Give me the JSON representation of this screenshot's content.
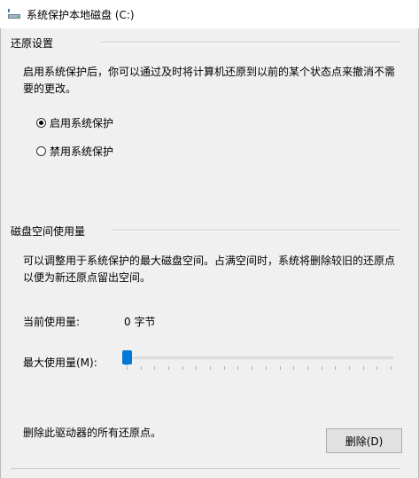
{
  "window": {
    "title": "系统保护本地磁盘 (C:)",
    "icon": "drive-icon"
  },
  "restore": {
    "group_title": "还原设置",
    "description": "启用系统保护后，你可以通过及时将计算机还原到以前的某个状态点来撤消不需要的更改。",
    "options": [
      {
        "label": "启用系统保护",
        "checked": true
      },
      {
        "label": "禁用系统保护",
        "checked": false
      }
    ]
  },
  "disk_space": {
    "group_title": "磁盘空间使用量",
    "description": "可以调整用于系统保护的最大磁盘空间。占满空间时，系统将删除较旧的还原点以便为新还原点留出空间。",
    "current_usage_label": "当前使用量:",
    "current_usage_value": "0 字节",
    "max_usage_label": "最大使用量(M):",
    "max_usage_fraction": 0.0
  },
  "delete": {
    "description": "删除此驱动器的所有还原点。",
    "button_label": "删除(D)"
  }
}
